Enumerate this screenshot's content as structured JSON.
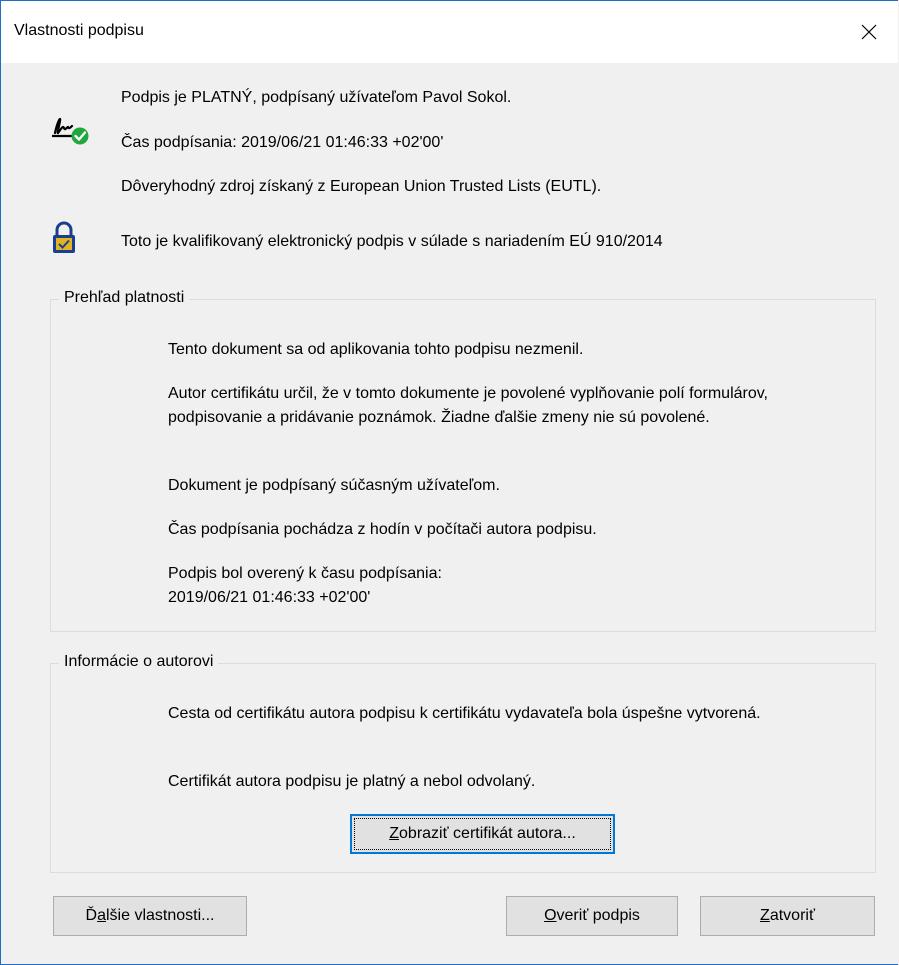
{
  "window": {
    "title": "Vlastnosti podpisu",
    "close_icon": "close-icon"
  },
  "status": {
    "signature_valid": "Podpis je PLATNÝ, podpísaný užívateľom Pavol Sokol.",
    "signing_time": "Čas podpísania:  2019/06/21 01:46:33 +02'00'",
    "trusted_source": "Dôveryhodný zdroj získaný z European Union Trusted Lists (EUTL).",
    "qualified": "Toto je kvalifikovaný elektronický podpis v súlade s nariadením EÚ 910/2014"
  },
  "validity": {
    "legend": "Prehľad platnosti",
    "items": [
      "Tento dokument sa od aplikovania tohto podpisu nezmenil.",
      "Autor certifikátu určil, že v tomto dokumente je povolené vyplňovanie polí formulárov, podpisovanie a pridávanie poznámok. Žiadne ďalšie zmeny nie sú povolené.",
      "Dokument je podpísaný súčasným užívateľom.",
      "Čas podpísania pochádza z hodín v počítači autora podpisu.",
      "Podpis bol overený k času podpísania:",
      "2019/06/21 01:46:33 +02'00'"
    ]
  },
  "author": {
    "legend": "Informácie o autorovi",
    "items": [
      "Cesta od certifikátu autora podpisu k certifikátu vydavateľa bola úspešne vytvorená.",
      "Certifikát autora podpisu je platný a nebol odvolaný."
    ],
    "show_cert_button": {
      "accel": "Z",
      "rest": "obraziť certifikát autora..."
    }
  },
  "footer": {
    "more_props": {
      "pre": "Ď",
      "accel": "a",
      "rest": "lšie vlastnosti..."
    },
    "verify": {
      "accel": "O",
      "rest": "veriť podpis"
    },
    "close": {
      "accel": "Z",
      "rest": "atvoriť"
    }
  },
  "colors": {
    "accent": "#0078d7",
    "check_green": "#1fa83c",
    "lock_blue": "#1a3f8f",
    "lock_gold": "#e0b422"
  }
}
